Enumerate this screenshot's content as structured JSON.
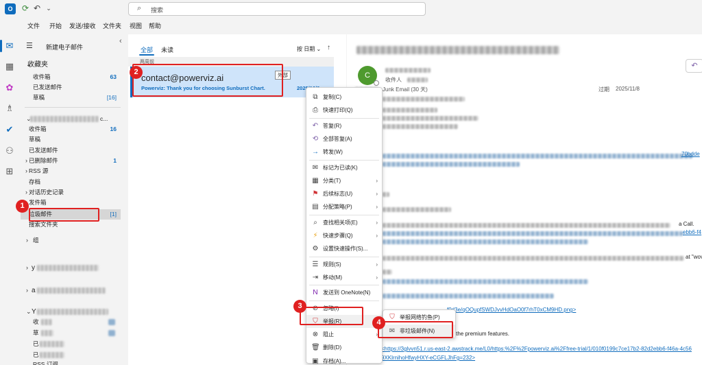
{
  "topbar": {
    "app_icon": "outlook-icon",
    "search_placeholder": "搜索"
  },
  "menubar": [
    "文件",
    "开始",
    "发送/接收",
    "文件夹",
    "视图",
    "帮助"
  ],
  "folder_pane": {
    "new_mail": "新建电子邮件",
    "favorites": {
      "header": "收藏夹",
      "items": [
        {
          "label": "收件箱",
          "count": "63"
        },
        {
          "label": "已发送邮件",
          "count": ""
        },
        {
          "label": "草稿",
          "count": "[16]"
        }
      ]
    },
    "account_suffix": "c...",
    "account_folders": [
      {
        "label": "收件箱",
        "count": "16",
        "chevron": ""
      },
      {
        "label": "草稿",
        "count": "",
        "chevron": ""
      },
      {
        "label": "已发送邮件",
        "count": "",
        "chevron": ""
      },
      {
        "label": "已删除邮件",
        "count": "1",
        "chevron": "›"
      },
      {
        "label": "RSS 源",
        "count": "",
        "chevron": "›"
      },
      {
        "label": "存档",
        "count": "",
        "chevron": ""
      },
      {
        "label": "对话历史记录",
        "count": "",
        "chevron": "›"
      },
      {
        "label": "发件箱",
        "count": "",
        "chevron": ""
      },
      {
        "label": "垃圾邮件",
        "count": "[1]",
        "chevron": ""
      },
      {
        "label": "搜索文件夹",
        "count": "",
        "chevron": ""
      }
    ],
    "group_label": "组",
    "other_account_prefixes": [
      "y",
      "a",
      "Y"
    ],
    "bottom_folders": [
      "收",
      "草",
      "已",
      "已",
      "RSS 订阅"
    ]
  },
  "message_list": {
    "tab_all": "全部",
    "tab_unread": "未读",
    "sort_label": "按 日期 ⌄",
    "group_header": "两周前",
    "item": {
      "sender": "contact@powerviz.ai",
      "tag": "外部",
      "subject": "Powerviz: Thank you for choosing Sunburst Chart.",
      "date": "2025/10/9"
    }
  },
  "reading_pane": {
    "avatar_letter": "C",
    "recipient_label": "收件人",
    "junk_note": "Junk Email (30 天)",
    "expiry_label": "过期",
    "expiry_date": "2025/11/8",
    "fragments": {
      "a": "a Call.",
      "b": "ebb6-f4",
      "c": "at \"wov",
      "d": "70bdde",
      "e": "f0d3e/qOQupfSWDJvvHdOaO0f7rhT0xCM9HD.png>",
      "f": "th all the premium features.",
      "g": "<https://3glvvn51.r.us-east-2.awstrack.me/L0/https:%2F%2Fpowerviz.ai%2Ffree-trial/1/010f0199c7ce17b2-82d2ebb6-f46a-4c56",
      "h": "9XKlrnihoHfwyHXY-eCGFLJhFg=232>"
    }
  },
  "context_menu": {
    "items": [
      {
        "icon": "copy-icon",
        "glyph": "⧉",
        "label": "复制(C)",
        "submenu": false,
        "color": "#444444"
      },
      {
        "icon": "print-icon",
        "glyph": "⎙",
        "label": "快速打印(Q)",
        "submenu": false,
        "color": "#444444"
      },
      {
        "sep": true
      },
      {
        "icon": "reply-icon",
        "glyph": "↶",
        "label": "答复(R)",
        "submenu": false,
        "color": "#7b5ea7"
      },
      {
        "icon": "reply-all-icon",
        "glyph": "⟲",
        "label": "全部答复(A)",
        "submenu": false,
        "color": "#7b5ea7"
      },
      {
        "icon": "forward-icon",
        "glyph": "→",
        "label": "转发(W)",
        "submenu": false,
        "color": "#0f6cbd"
      },
      {
        "sep": true
      },
      {
        "icon": "mark-read-icon",
        "glyph": "✉",
        "label": "标记为已读(K)",
        "submenu": false,
        "color": "#444444"
      },
      {
        "icon": "categorize-icon",
        "glyph": "▦",
        "label": "分类(T)",
        "submenu": true,
        "color": "#444444"
      },
      {
        "icon": "flag-icon",
        "glyph": "⚑",
        "label": "后续标志(U)",
        "submenu": true,
        "color": "#d13438"
      },
      {
        "icon": "policy-icon",
        "glyph": "▤",
        "label": "分配策略(P)",
        "submenu": true,
        "color": "#444444"
      },
      {
        "sep": true
      },
      {
        "icon": "find-related-icon",
        "glyph": "⌕",
        "label": "查找相关项(E)",
        "submenu": true,
        "color": "#444444"
      },
      {
        "icon": "quick-steps-icon",
        "glyph": "⚡",
        "label": "快速步骤(Q)",
        "submenu": true,
        "color": "#e8a317"
      },
      {
        "icon": "quick-actions-icon",
        "glyph": "⚙",
        "label": "设置快速操作(S)...",
        "submenu": false,
        "color": "#444444"
      },
      {
        "sep": true
      },
      {
        "icon": "rules-icon",
        "glyph": "☰",
        "label": "规则(S)",
        "submenu": true,
        "color": "#444444"
      },
      {
        "icon": "move-icon",
        "glyph": "⇥",
        "label": "移动(M)",
        "submenu": true,
        "color": "#444444"
      },
      {
        "sep": true
      },
      {
        "icon": "onenote-icon",
        "glyph": "N",
        "label": "发送到 OneNote(N)",
        "submenu": false,
        "color": "#7719aa"
      },
      {
        "sep": true
      },
      {
        "icon": "ignore-icon",
        "glyph": "⊘",
        "label": "忽略(I)",
        "submenu": false,
        "color": "#444444"
      },
      {
        "icon": "report-icon",
        "glyph": "⛉",
        "label": "举报(R)",
        "submenu": true,
        "color": "#d13438"
      },
      {
        "icon": "block-icon",
        "glyph": "⊗",
        "label": "阻止",
        "submenu": true,
        "color": "#444444"
      },
      {
        "icon": "delete-icon",
        "glyph": "🗑",
        "label": "删除(D)",
        "submenu": false,
        "color": "#444444"
      },
      {
        "icon": "archive-icon",
        "glyph": "▣",
        "label": "存档(A)...",
        "submenu": false,
        "color": "#444444"
      }
    ]
  },
  "report_submenu": {
    "items": [
      {
        "icon": "phishing-icon",
        "glyph": "⛉",
        "label": "举报网络钓鱼(P)",
        "color": "#d13438"
      },
      {
        "icon": "not-junk-icon",
        "glyph": "✉",
        "label": "非垃圾邮件(N)",
        "color": "#555555"
      }
    ]
  },
  "annotations": [
    "1",
    "2",
    "3",
    "4"
  ],
  "colors": {
    "accent": "#0f6cbd",
    "annotation": "#e02020",
    "selected_item": "#cfe4fa"
  }
}
